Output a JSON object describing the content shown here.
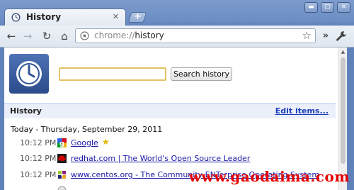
{
  "tab": {
    "title": "History",
    "close": "✕"
  },
  "new_tab": "+",
  "window_controls": {
    "minimize": "▬",
    "maximize": "▢",
    "close": "✕"
  },
  "toolbar": {
    "back": "←",
    "forward": "→",
    "reload": "↻",
    "home": "⌂",
    "url_scheme": "chrome://",
    "url_path": "history",
    "bookmark_star": "☆",
    "overflow": "»",
    "menu": "🔧"
  },
  "page": {
    "search_button": "Search history",
    "section_title": "History",
    "edit_items": "Edit items...",
    "day": "Today - Thursday, September 29, 2011",
    "entries": [
      {
        "time": "10:12 PM",
        "title": "Google",
        "starred": true,
        "favicon": "google-icon"
      },
      {
        "time": "10:12 PM",
        "title": "redhat.com | The World's Open Source Leader",
        "favicon": "redhat-icon"
      },
      {
        "time": "10:12 PM",
        "title": "www.centos.org - The Community ENTerprise Operating System",
        "favicon": "centos-icon"
      },
      {
        "time": "",
        "title": "",
        "favicon": "generic-page-icon"
      }
    ]
  },
  "watermark": "www.gaodaima.com",
  "colors": {
    "frame": "#6b8dc3",
    "section_bar": "#ebeff9",
    "link": "#1a1aa6",
    "watermark": "#e60000"
  }
}
